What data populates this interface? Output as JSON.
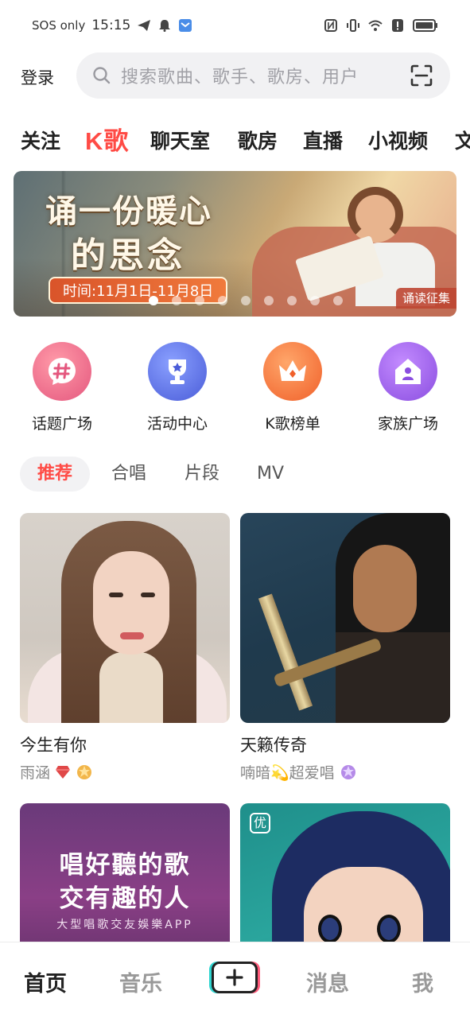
{
  "status_bar": {
    "carrier": "SOS only",
    "time": "15:15"
  },
  "header": {
    "login_label": "登录",
    "search_placeholder": "搜索歌曲、歌手、歌房、用户"
  },
  "top_tabs": [
    {
      "label": "关注"
    },
    {
      "label": "K歌",
      "active": true
    },
    {
      "label": "聊天室"
    },
    {
      "label": "歌房"
    },
    {
      "label": "直播"
    },
    {
      "label": "小视频"
    },
    {
      "label": "文"
    }
  ],
  "banner": {
    "title_line1": "诵一份暖心",
    "title_line2": "的思念",
    "date": "时间:11月1日-11月8日",
    "tag": "诵读征集",
    "page_count": 9,
    "current_page": 1
  },
  "quick_entries": [
    {
      "label": "话题广场",
      "icon": "hashtag-bubble-icon",
      "color": "#f06a8a"
    },
    {
      "label": "活动中心",
      "icon": "trophy-icon",
      "color": "#5b6ee0"
    },
    {
      "label": "K歌榜单",
      "icon": "crown-icon",
      "color": "#f26b30"
    },
    {
      "label": "家族广场",
      "icon": "house-icon",
      "color": "#9a5ce0"
    }
  ],
  "sub_tabs": [
    {
      "label": "推荐",
      "active": true
    },
    {
      "label": "合唱"
    },
    {
      "label": "片段"
    },
    {
      "label": "MV"
    }
  ],
  "feed": [
    {
      "title": "今生有你",
      "user": "雨涵"
    },
    {
      "title": "天籁传奇",
      "user": "喃暗💫超爱唱"
    },
    {
      "promo_line1": "唱好聽的歌",
      "promo_line2": "交有趣的人",
      "promo_line3": "大型唱歌交友娛樂APP"
    },
    {
      "badge": "优"
    }
  ],
  "bottom_nav": [
    {
      "label": "首页",
      "active": true
    },
    {
      "label": "音乐"
    },
    {
      "label": "消息"
    },
    {
      "label": "我"
    }
  ],
  "colors": {
    "accent": "#ff4b45",
    "search_bg": "#f1f1f3"
  }
}
